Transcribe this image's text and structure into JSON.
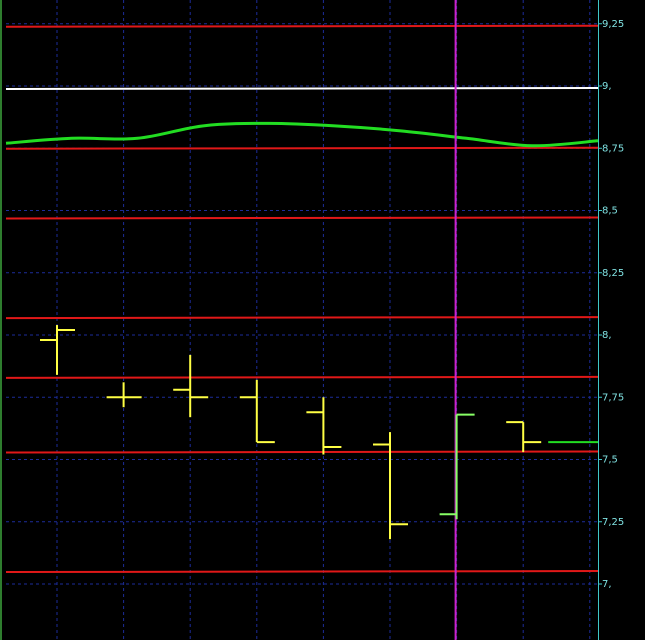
{
  "chart_data": {
    "type": "ohlc",
    "ylim": [
      6.95,
      9.3
    ],
    "y_ticks": [
      {
        "value": 9.25,
        "label": "9,25"
      },
      {
        "value": 9.0,
        "label": "9,"
      },
      {
        "value": 8.75,
        "label": "8,75"
      },
      {
        "value": 8.5,
        "label": "8,5"
      },
      {
        "value": 8.25,
        "label": "8,25"
      },
      {
        "value": 8.0,
        "label": "8,"
      },
      {
        "value": 7.75,
        "label": "7,75"
      },
      {
        "value": 7.5,
        "label": "7,5"
      },
      {
        "value": 7.25,
        "label": "7,25"
      },
      {
        "value": 7.0,
        "label": "7,"
      }
    ],
    "bars": [
      {
        "open": 7.98,
        "high": 8.04,
        "low": 7.84,
        "close": 8.02,
        "color": "#ffff44"
      },
      {
        "open": 7.75,
        "high": 7.81,
        "low": 7.71,
        "close": 7.75,
        "color": "#ffff44"
      },
      {
        "open": 7.78,
        "high": 7.92,
        "low": 7.67,
        "close": 7.75,
        "color": "#ffff44"
      },
      {
        "open": 7.75,
        "high": 7.82,
        "low": 7.57,
        "close": 7.57,
        "color": "#ffff44"
      },
      {
        "open": 7.69,
        "high": 7.75,
        "low": 7.52,
        "close": 7.55,
        "color": "#ffff44"
      },
      {
        "open": 7.56,
        "high": 7.61,
        "low": 7.18,
        "close": 7.24,
        "color": "#ffff44"
      },
      {
        "open": 7.28,
        "high": 7.68,
        "low": 7.26,
        "close": 7.68,
        "color": "#88ff66"
      },
      {
        "open": 7.65,
        "high": 7.65,
        "low": 7.53,
        "close": 7.57,
        "color": "#ffff44"
      }
    ],
    "last_value_line": {
      "value": 7.57,
      "color": "#22dd22"
    },
    "horizontal_levels": [
      {
        "value": 9.24,
        "color": "#e01818"
      },
      {
        "value": 8.99,
        "color": "#ffffff"
      },
      {
        "value": 8.75,
        "color": "#e01818"
      },
      {
        "value": 8.47,
        "color": "#e01818"
      },
      {
        "value": 8.07,
        "color": "#e01818"
      },
      {
        "value": 7.83,
        "color": "#e01818"
      },
      {
        "value": 7.53,
        "color": "#e01818"
      },
      {
        "value": 7.05,
        "color": "#e01818"
      }
    ],
    "moving_average": {
      "color": "#22dd22",
      "values": [
        8.77,
        8.79,
        8.79,
        8.84,
        8.85,
        8.84,
        8.82,
        8.79,
        8.76,
        8.78
      ]
    },
    "vertical_marker": {
      "bar_index": 6,
      "color": "#cc22cc"
    },
    "grid": true,
    "colors": {
      "background": "#000000",
      "grid": "#1c2c9a",
      "axis": "#3fc8c8",
      "tick_text": "#7fe0e0"
    }
  }
}
